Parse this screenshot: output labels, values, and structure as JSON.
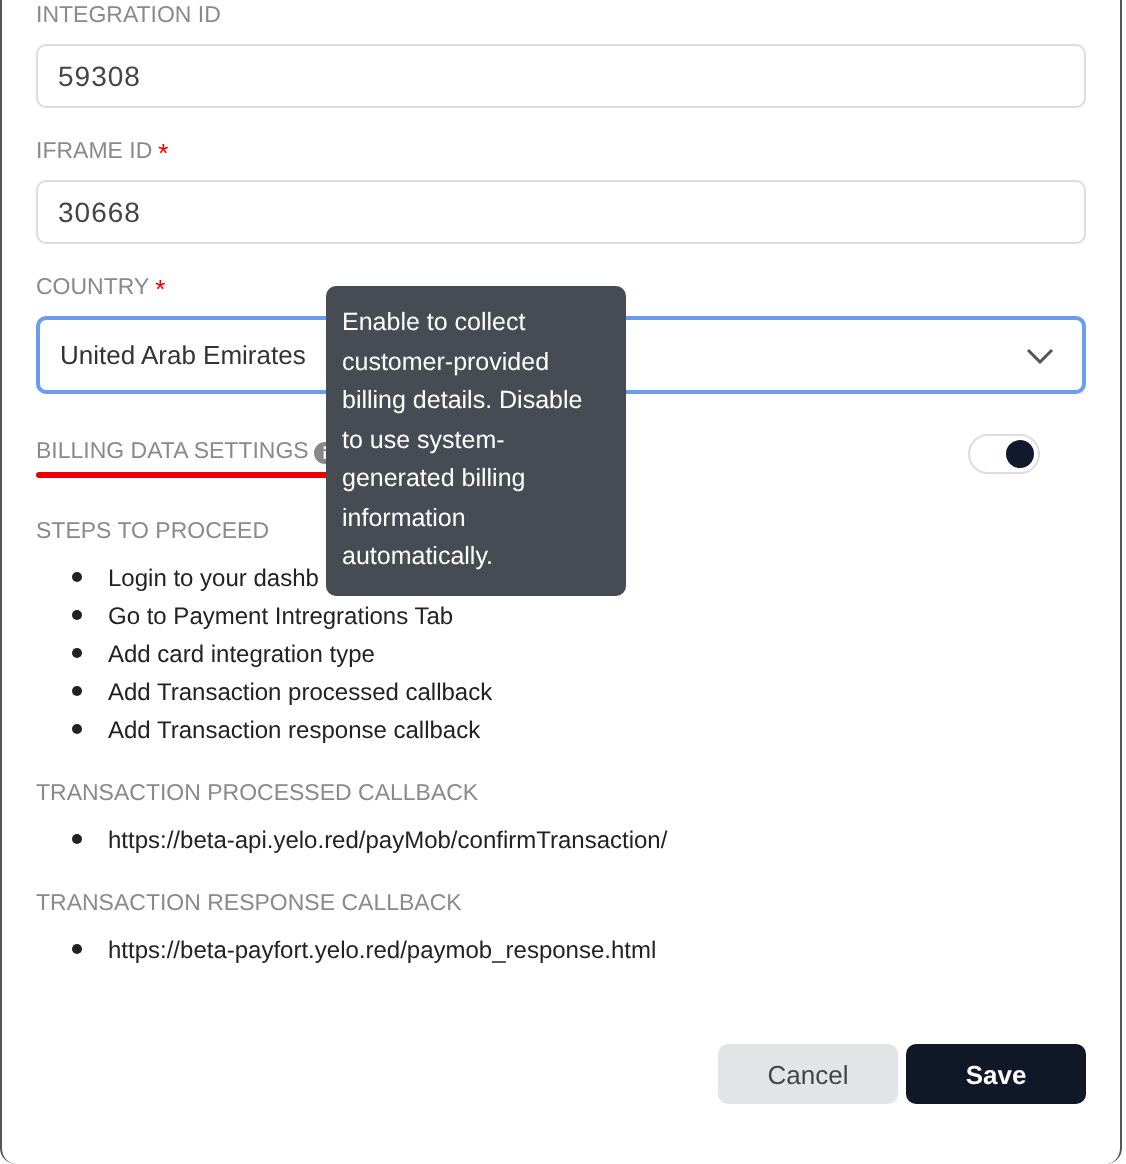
{
  "fields": [
    {
      "label": "INTEGRATION ID",
      "required": false,
      "kind": "text",
      "value": "59308"
    },
    {
      "label": "IFRAME ID",
      "required": true,
      "kind": "text",
      "value": "30668"
    },
    {
      "label": "COUNTRY",
      "required": true,
      "kind": "select",
      "value": "United Arab Emirates",
      "focused": true
    }
  ],
  "required_mark": "*",
  "billing": {
    "label": "BILLING DATA SETTINGS",
    "on": true,
    "tooltip": "Enable to collect customer-provided billing details. Disable to use system-generated billing information automatically."
  },
  "sections": [
    {
      "heading": "STEPS TO PROCEED",
      "items": [
        "Login to your dashb",
        "Go to Payment Intregrations Tab",
        "Add card integration type",
        "Add Transaction processed callback",
        "Add Transaction response callback"
      ]
    },
    {
      "heading": "TRANSACTION PROCESSED CALLBACK",
      "items": [
        "https://beta-api.yelo.red/payMob/confirmTransaction/"
      ]
    },
    {
      "heading": "TRANSACTION RESPONSE CALLBACK",
      "items": [
        "https://beta-payfort.yelo.red/paymob_response.html"
      ]
    }
  ],
  "buttons": [
    {
      "label": "Cancel",
      "kind": "secondary"
    },
    {
      "label": "Save",
      "kind": "primary"
    }
  ]
}
